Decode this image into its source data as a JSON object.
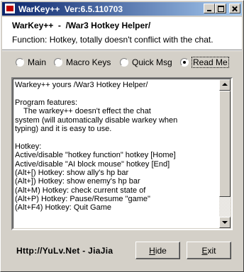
{
  "window": {
    "title": "WarKey++  Ver:6.5.110703"
  },
  "header": {
    "title": "WarKey++  -  /War3 Hotkey Helper/",
    "subtitle": "Function: Hotkey, totally doesn't conflict with the chat."
  },
  "tabs": [
    {
      "label": "Main",
      "selected": false
    },
    {
      "label": "Macro Keys",
      "selected": false
    },
    {
      "label": "Quick Msg",
      "selected": false
    },
    {
      "label": "Read Me",
      "selected": true
    }
  ],
  "readme": {
    "lines": [
      "Warkey++ yours /War3 Hotkey Helper/",
      "",
      "Program features:",
      "    The warkey++ doesn't effect the chat",
      "system (will automatically disable warkey when",
      "typing) and it is easy to use.",
      "",
      "Hotkey:",
      "Active/disable \"hotkey function\" hotkey [Home]",
      "Active/disable \"AI block mouse\" hotkey [End]",
      "(Alt+[) Hotkey: show ally's hp bar",
      "(Alt+]) Hotkey: show enemy's hp bar",
      "(Alt+M) Hotkey: check current state of",
      "(Alt+P) Hotkey: Pause/Resume \"game\"",
      "(Alt+F4) Hotkey: Quit Game",
      "",
      ""
    ]
  },
  "footer": {
    "link": "Http://YuLv.Net - JiaJia",
    "hide_first": "H",
    "hide_rest": "ide",
    "exit_first": "E",
    "exit_rest": "xit"
  },
  "colors": {
    "title_start": "#0a246a",
    "title_end": "#a6caf0",
    "face": "#d4d0c8"
  }
}
